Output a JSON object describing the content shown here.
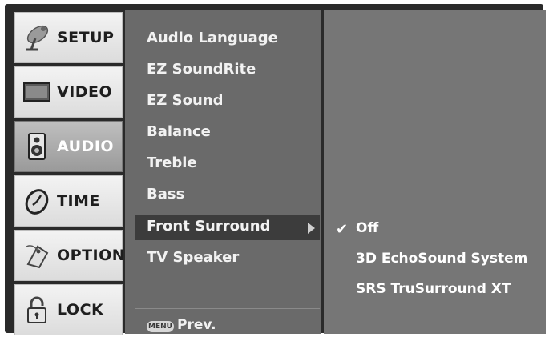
{
  "categories": [
    {
      "label": "SETUP",
      "icon": "satellite-dish-icon",
      "active": false
    },
    {
      "label": "VIDEO",
      "icon": "monitor-icon",
      "active": false
    },
    {
      "label": "AUDIO",
      "icon": "speaker-icon",
      "active": true
    },
    {
      "label": "TIME",
      "icon": "clock-icon",
      "active": false
    },
    {
      "label": "OPTION",
      "icon": "tag-icon",
      "active": false
    },
    {
      "label": "LOCK",
      "icon": "padlock-icon",
      "active": false
    }
  ],
  "audio_menu": {
    "items": [
      {
        "label": "Audio Language"
      },
      {
        "label": "EZ SoundRite"
      },
      {
        "label": "EZ Sound"
      },
      {
        "label": "Balance"
      },
      {
        "label": "Treble"
      },
      {
        "label": "Bass"
      },
      {
        "label": "Front Surround",
        "selected": true
      },
      {
        "label": "TV Speaker"
      }
    ],
    "footer": {
      "menu_key": "MENU",
      "prev_label": "Prev."
    }
  },
  "front_surround_options": {
    "checked_index": 0,
    "check_mark": "✔",
    "items": [
      "Off",
      "3D EchoSound System",
      "SRS TruSurround XT"
    ]
  }
}
